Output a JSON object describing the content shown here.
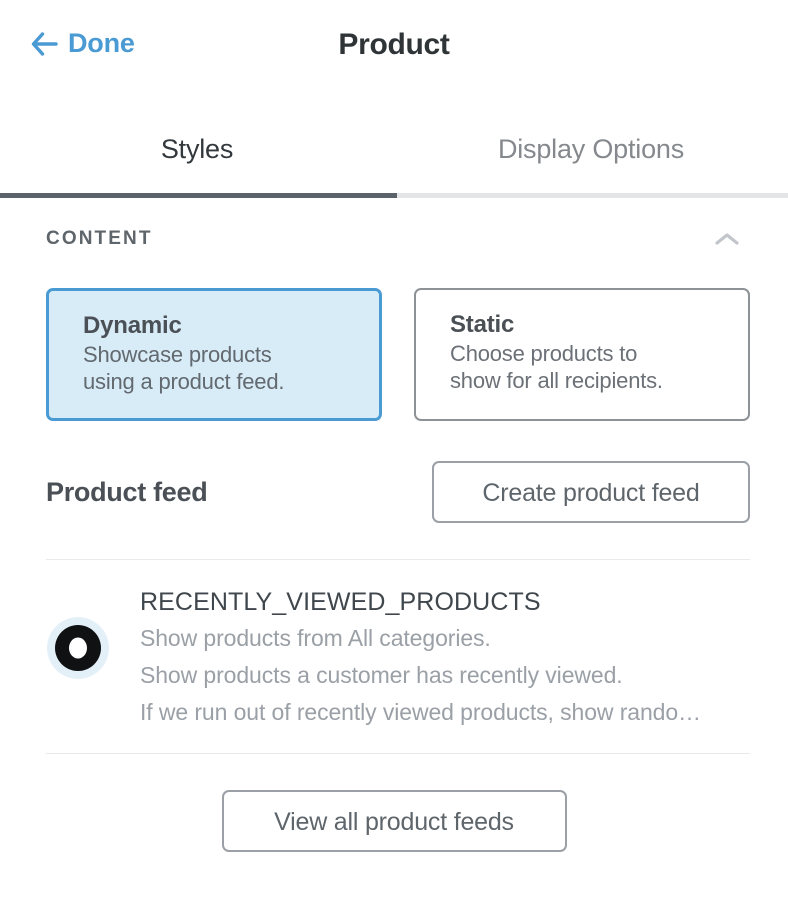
{
  "header": {
    "back_label": "Done",
    "back_icon": "arrow-left-icon",
    "title": "Product"
  },
  "tabs": [
    {
      "label": "Styles",
      "active": true
    },
    {
      "label": "Display Options",
      "active": false
    }
  ],
  "section": {
    "title": "CONTENT",
    "collapse_icon": "chevron-up-icon",
    "expanded": true
  },
  "content_options": [
    {
      "title": "Dynamic",
      "description_line1": "Showcase products",
      "description_line2": "using a product feed.",
      "selected": true
    },
    {
      "title": "Static",
      "description_line1": "Choose products to",
      "description_line2": "show for all recipients.",
      "selected": false
    }
  ],
  "product_feed": {
    "heading": "Product feed",
    "create_button": "Create product feed",
    "view_all_button": "View all product feeds",
    "items": [
      {
        "icon": "product-feed-ring-icon",
        "name": "RECENTLY_VIEWED_PRODUCTS",
        "line1": "Show products from All categories.",
        "line2": "Show products a customer has recently viewed.",
        "line3": "If we run out of recently viewed products, show rando…",
        "selected": true
      }
    ]
  },
  "colors": {
    "accent_blue": "#4a9ad4",
    "selected_card_bg": "#d8ecf8",
    "active_tab_underline": "#5b6269",
    "inactive_tab_underline": "#e3e5e7",
    "heading_text": "#4a5056",
    "muted_text": "#9aa0a6",
    "border_gray": "#9aa0a5"
  }
}
